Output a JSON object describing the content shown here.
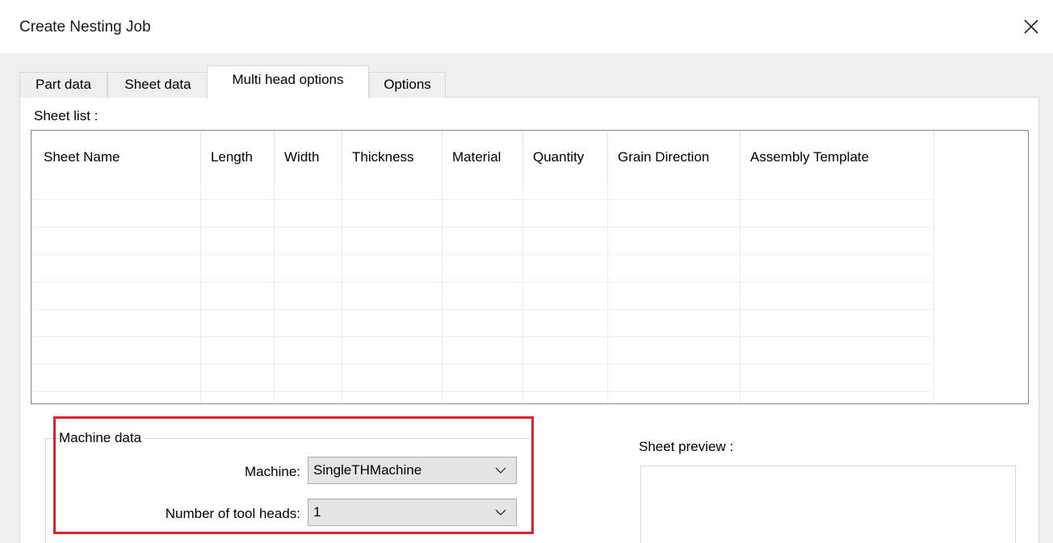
{
  "window": {
    "title": "Create Nesting Job",
    "close_icon": "close-icon"
  },
  "tabs": [
    {
      "label": "Part data",
      "active": false
    },
    {
      "label": "Sheet data",
      "active": false
    },
    {
      "label": "Multi head options",
      "active": true
    },
    {
      "label": "Options",
      "active": false
    }
  ],
  "sheet_list": {
    "label": "Sheet list :",
    "columns": [
      "Sheet Name",
      "Length",
      "Width",
      "Thickness",
      "Material",
      "Quantity",
      "Grain Direction",
      "Assembly Template"
    ],
    "rows": []
  },
  "machine_data": {
    "group_label": "Machine data",
    "machine_label": "Machine:",
    "machine_value": "SingleTHMachine",
    "tool_heads_label": "Number of tool heads:",
    "tool_heads_value": "1",
    "highlight_color": "#e0202e"
  },
  "sheet_preview": {
    "label": "Sheet preview :"
  }
}
